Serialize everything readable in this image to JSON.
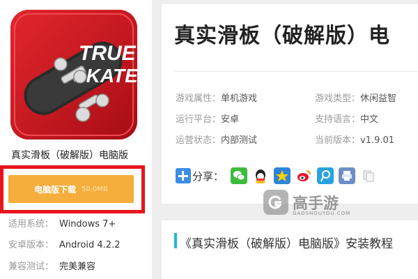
{
  "app": {
    "name": "真实滑板（破解版）电脑版",
    "title": "真实滑板（破解版）电",
    "icon_text_line1": "TRUE",
    "icon_text_line2": "SKATE"
  },
  "download": {
    "label": "电脑版下载",
    "size": "50.0MB"
  },
  "left_info": [
    {
      "key": "适用系统：",
      "value": "Windows 7+"
    },
    {
      "key": "安卓版本：",
      "value": "Android 4.2.2"
    },
    {
      "key": "兼容测试：",
      "value": "完美兼容"
    }
  ],
  "attributes": [
    {
      "key": "游戏属性：",
      "value": "单机游戏"
    },
    {
      "key": "游戏类型：",
      "value": "休闲益智"
    },
    {
      "key": "运行平台：",
      "value": "安卓"
    },
    {
      "key": "支持语言：",
      "value": "中文"
    },
    {
      "key": "运营状态：",
      "value": "内部测试"
    },
    {
      "key": "当前版本：",
      "value": "v1.9.01"
    }
  ],
  "share": {
    "label": "分享：",
    "icons": [
      "wechat-icon",
      "qq-icon",
      "qzone-icon",
      "weibo-icon",
      "tencent-weibo-icon",
      "print-icon",
      "copy-icon"
    ]
  },
  "section": {
    "title": "《真实滑板（破解版）电脑版》安装教程"
  },
  "watermark": {
    "text": "高手游",
    "sub": "GAOSHOUYOU.COM"
  },
  "colors": {
    "download_button": "#f5ad3c",
    "highlight_frame": "#e8141c",
    "section_accent": "#22b6d8",
    "icon_red": "#d92027"
  }
}
